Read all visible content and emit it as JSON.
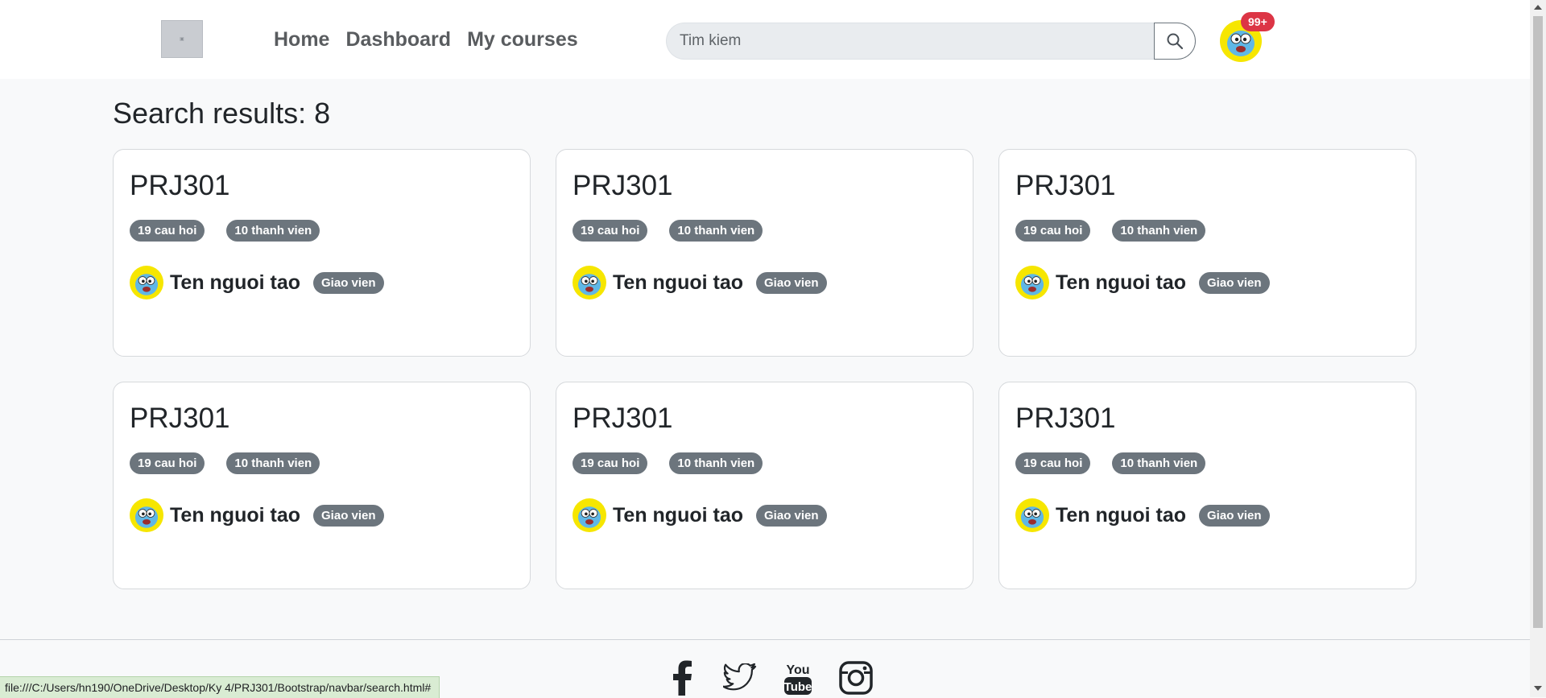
{
  "nav": {
    "links": [
      "Home",
      "Dashboard",
      "My courses"
    ],
    "search_placeholder": "Tim kiem",
    "notification_count": "99+"
  },
  "results": {
    "title": "Search results: 8"
  },
  "cards": [
    {
      "title": "PRJ301",
      "questions": "19 cau hoi",
      "members": "10 thanh vien",
      "creator": "Ten nguoi tao",
      "role": "Giao vien"
    },
    {
      "title": "PRJ301",
      "questions": "19 cau hoi",
      "members": "10 thanh vien",
      "creator": "Ten nguoi tao",
      "role": "Giao vien"
    },
    {
      "title": "PRJ301",
      "questions": "19 cau hoi",
      "members": "10 thanh vien",
      "creator": "Ten nguoi tao",
      "role": "Giao vien"
    },
    {
      "title": "PRJ301",
      "questions": "19 cau hoi",
      "members": "10 thanh vien",
      "creator": "Ten nguoi tao",
      "role": "Giao vien"
    },
    {
      "title": "PRJ301",
      "questions": "19 cau hoi",
      "members": "10 thanh vien",
      "creator": "Ten nguoi tao",
      "role": "Giao vien"
    },
    {
      "title": "PRJ301",
      "questions": "19 cau hoi",
      "members": "10 thanh vien",
      "creator": "Ten nguoi tao",
      "role": "Giao vien"
    }
  ],
  "footer": {
    "social_icons": [
      "facebook-icon",
      "twitter-icon",
      "youtube-icon",
      "instagram-icon"
    ],
    "youtube_text_top": "You",
    "youtube_text_bottom": "Tube"
  },
  "status_bar": {
    "url": "file:///C:/Users/hn190/OneDrive/Desktop/Ky 4/PRJ301/Bootstrap/navbar/search.html#"
  },
  "colors": {
    "badge_gray": "#6c757d",
    "notification_red": "#dc3545",
    "avatar_yellow": "#f6e600",
    "avatar_blue": "#5fb7e6"
  }
}
